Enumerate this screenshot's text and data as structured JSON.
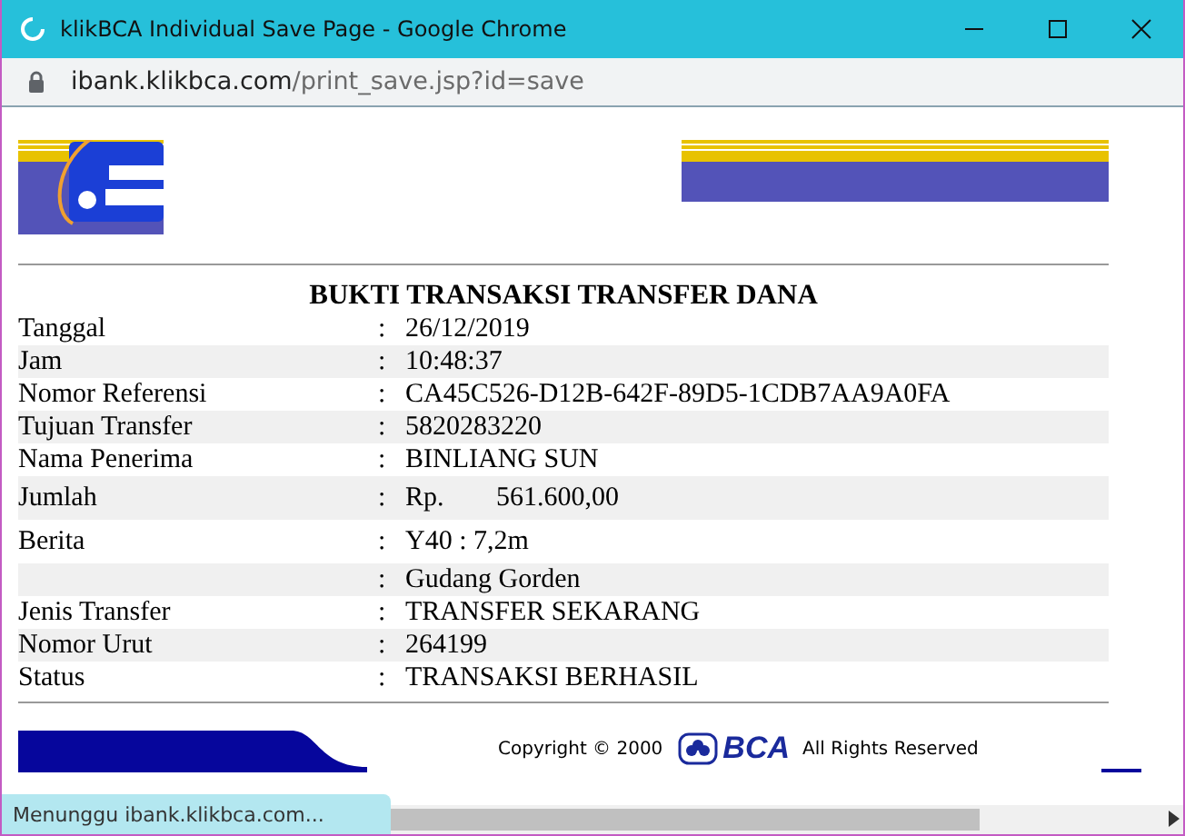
{
  "window": {
    "title": "klikBCA Individual Save Page - Google Chrome"
  },
  "address_bar": {
    "host": "ibank.klikbca.com",
    "path": "/print_save.jsp?id=save"
  },
  "receipt": {
    "title": "BUKTI TRANSAKSI TRANSFER DANA",
    "rows": [
      {
        "label": "Tanggal",
        "separator": ":",
        "value": "26/12/2019"
      },
      {
        "label": "Jam",
        "separator": ":",
        "value": "10:48:37"
      },
      {
        "label": "Nomor Referensi",
        "separator": ":",
        "value": "CA45C526-D12B-642F-89D5-1CDB7AA9A0FA"
      },
      {
        "label": "Tujuan Transfer",
        "separator": ":",
        "value": "5820283220"
      },
      {
        "label": "Nama Penerima",
        "separator": ":",
        "value": "BINLIANG SUN"
      },
      {
        "label": "Jumlah",
        "separator": ":",
        "kind": "amount",
        "currency": "Rp.",
        "value": "561.600,00"
      },
      {
        "label": "Berita",
        "separator": ":",
        "value": "Y40 : 7,2m",
        "kind": "tall"
      },
      {
        "separator": ":",
        "value": "Gudang Gorden"
      },
      {
        "label": "Jenis Transfer",
        "separator": ":",
        "value": "TRANSFER SEKARANG"
      },
      {
        "label": "Nomor Urut",
        "separator": ":",
        "value": "264199"
      },
      {
        "label": "Status",
        "separator": ":",
        "value": "TRANSAKSI BERHASIL"
      }
    ]
  },
  "footer": {
    "copyright": "Copyright © 2000",
    "brand": "BCA",
    "rights": "All Rights Reserved"
  },
  "status_bar": {
    "text": "Menunggu ibank.klikbca.com..."
  }
}
